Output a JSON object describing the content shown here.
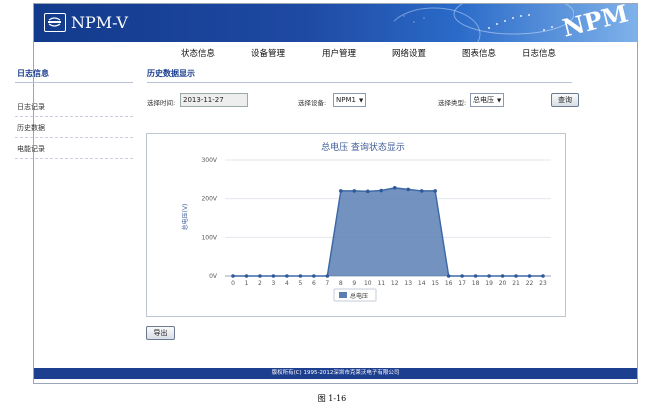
{
  "header": {
    "title": "NPM-V",
    "brand_mark": "NPM"
  },
  "nav": {
    "items": [
      "状态信息",
      "设备管理",
      "用户管理",
      "网络设置",
      "图表信息",
      "日志信息"
    ]
  },
  "sidebar": {
    "title": "日志信息",
    "items": [
      "日志记录",
      "历史数据",
      "电能记录"
    ]
  },
  "main": {
    "section_title": "历史数据显示",
    "filters": {
      "time_label": "选择时间:",
      "time_value": "2013-11-27",
      "device_label": "选择设备:",
      "device_value": "NPM1",
      "type_label": "选择类型:",
      "type_value": "总电压",
      "query_button": "查询"
    },
    "export_button": "导出"
  },
  "chart_data": {
    "type": "area",
    "title": "总电压 查询状态显示",
    "ylabel": "总电压(V)",
    "xlabel": "",
    "categories": [
      "0",
      "1",
      "2",
      "3",
      "4",
      "5",
      "6",
      "7",
      "8",
      "9",
      "10",
      "11",
      "12",
      "13",
      "14",
      "15",
      "16",
      "17",
      "18",
      "19",
      "20",
      "21",
      "22",
      "23"
    ],
    "y_ticks": [
      "0V",
      "100V",
      "200V",
      "300V"
    ],
    "ylim": [
      0,
      300
    ],
    "series": [
      {
        "name": "总电压",
        "values": [
          0,
          0,
          0,
          0,
          0,
          0,
          0,
          0,
          220,
          220,
          219,
          221,
          228,
          224,
          220,
          220,
          0,
          0,
          0,
          0,
          0,
          0,
          0,
          0
        ]
      }
    ],
    "legend_position": "bottom-center",
    "grid": true,
    "colors": {
      "fill": "#5b7fb4",
      "line": "#3f6aa8",
      "marker": "#2f5a99"
    }
  },
  "footer": {
    "copyright": "版权所有(C) 1995-2012深圳市克莱沃电子有限公司"
  },
  "caption": "图 1-16"
}
